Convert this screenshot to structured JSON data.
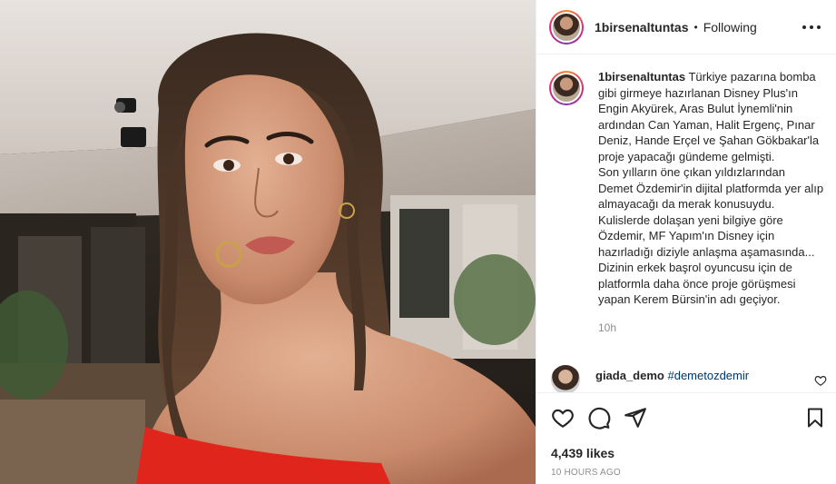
{
  "post": {
    "image": {
      "icon": "photo-portrait"
    },
    "header": {
      "username": "1birsenaltuntas",
      "separator": "•",
      "follow_status": "Following",
      "more_icon": "more-horizontal-icon"
    },
    "caption": {
      "username": "1birsenaltuntas",
      "text": "Türkiye pazarına bomba gibi girmeye hazırlanan Disney Plus'ın Engin Akyürek, Aras Bulut İynemli'nin ardından Can Yaman, Halit Ergenç, Pınar Deniz, Hande Erçel ve Şahan Gökbakar'la proje yapacağı gündeme gelmişti.",
      "lines": [
        "Son yılların öne çıkan yıldızlarından",
        "Demet Özdemir'in dijital platformda yer alıp almayacağı da merak konusuydu.",
        "Kulislerde dolaşan yeni bilgiye göre Özdemir, MF Yapım'ın Disney için hazırladığı diziyle anlaşma aşamasında...",
        "Dizinin erkek başrol oyuncusu için de platformla daha önce proje görüşmesi yapan Kerem Bürsin'in adı geçiyor."
      ],
      "time": "10h"
    },
    "comment": {
      "username": "giada_demo",
      "hashtag": "#demetozdemir",
      "like_icon": "heart-outline-icon"
    },
    "actions": {
      "like_icon": "heart-icon",
      "comment_icon": "comment-icon",
      "share_icon": "send-icon",
      "save_icon": "bookmark-icon"
    },
    "likes": "4,439 likes",
    "date": "10 HOURS AGO"
  },
  "colors": {
    "text": "#262626",
    "muted": "#8e8e8e",
    "link": "#00376b",
    "border": "#efefef",
    "dress_red": "#e0261c"
  }
}
